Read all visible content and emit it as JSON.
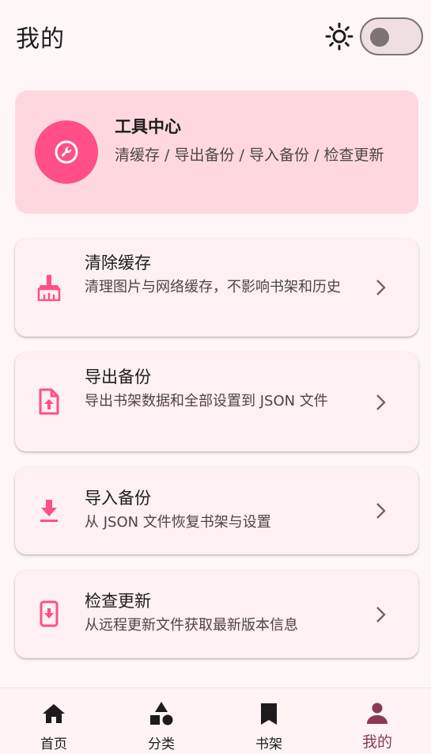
{
  "header": {
    "title": "我的",
    "theme_icon": "sun-icon",
    "dark_mode_toggle": {
      "on": false
    }
  },
  "hero": {
    "icon": "wrench-icon",
    "title": "工具中心",
    "subtitle": "清缓存 / 导出备份 / 导入备份 / 检查更新"
  },
  "tools": [
    {
      "icon": "broom-icon",
      "label": "清除缓存",
      "description": "清理图片与网络缓存，不影响书架和历史"
    },
    {
      "icon": "file-upload-icon",
      "label": "导出备份",
      "description": "导出书架数据和全部设置到 JSON 文件"
    },
    {
      "icon": "download-icon",
      "label": "导入备份",
      "description": "从 JSON 文件恢复书架与设置"
    },
    {
      "icon": "phone-update-icon",
      "label": "检查更新",
      "description": "从远程更新文件获取最新版本信息"
    }
  ],
  "nav": [
    {
      "icon": "home-icon",
      "label": "首页",
      "active": false
    },
    {
      "icon": "category-icon",
      "label": "分类",
      "active": false
    },
    {
      "icon": "bookmark-icon",
      "label": "书架",
      "active": false
    },
    {
      "icon": "person-icon",
      "label": "我的",
      "active": true
    }
  ],
  "colors": {
    "accent": "#ff4f86",
    "hero_bg": "#ffd8df",
    "card_bg": "#fff0f1",
    "page_bg": "#fff7f7",
    "active_nav": "#8a3a55"
  }
}
